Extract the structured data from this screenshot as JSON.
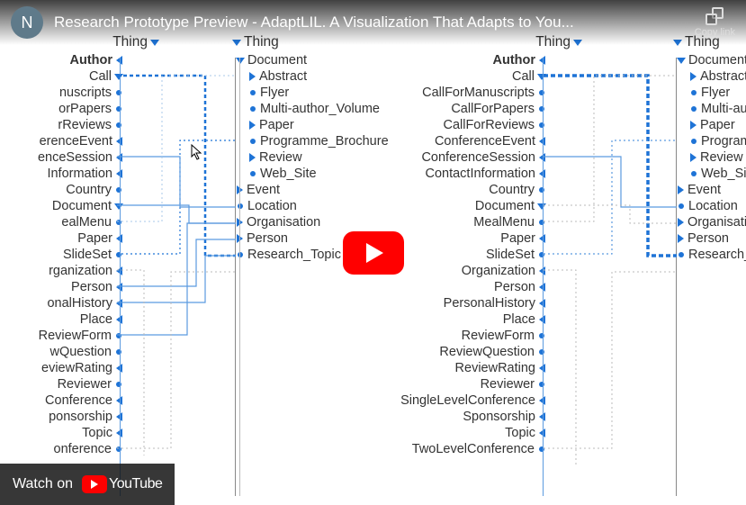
{
  "header": {
    "avatar_initial": "N",
    "title": "Research Prototype Preview - AdaptLIL. A Visualization That Adapts to You...",
    "copy_link": "Copy link"
  },
  "panels": {
    "p1": {
      "head": "Thing",
      "items": [
        {
          "label": "Author",
          "marker": "tri-left",
          "hi": true
        },
        {
          "label": "Call",
          "marker": "tri-down"
        },
        {
          "label": "nuscripts",
          "marker": "dot"
        },
        {
          "label": "orPapers",
          "marker": "dot"
        },
        {
          "label": "rReviews",
          "marker": "dot"
        },
        {
          "label": "erenceEvent",
          "marker": "tri-left"
        },
        {
          "label": "enceSession",
          "marker": "tri-left"
        },
        {
          "label": "Information",
          "marker": "tri-left"
        },
        {
          "label": "Country",
          "marker": "dot"
        },
        {
          "label": "Document",
          "marker": "tri-down"
        },
        {
          "label": "ealMenu",
          "marker": "dot"
        },
        {
          "label": "Paper",
          "marker": "tri-left"
        },
        {
          "label": "SlideSet",
          "marker": "dot"
        },
        {
          "label": "rganization",
          "marker": "tri-left"
        },
        {
          "label": "Person",
          "marker": "tri-left"
        },
        {
          "label": "onalHistory",
          "marker": "tri-left"
        },
        {
          "label": "Place",
          "marker": "tri-left"
        },
        {
          "label": "ReviewForm",
          "marker": "dot"
        },
        {
          "label": "wQuestion",
          "marker": "dot"
        },
        {
          "label": "eviewRating",
          "marker": "tri-left"
        },
        {
          "label": "Reviewer",
          "marker": "dot"
        },
        {
          "label": "Conference",
          "marker": "tri-left"
        },
        {
          "label": "ponsorship",
          "marker": "tri-left"
        },
        {
          "label": "Topic",
          "marker": "tri-left"
        },
        {
          "label": "onference",
          "marker": "dot"
        }
      ]
    },
    "p2": {
      "head": "Thing",
      "items": [
        {
          "label": "Document",
          "marker": "tri-down",
          "indent": 0
        },
        {
          "label": "Abstract",
          "marker": "tri-right",
          "indent": 1
        },
        {
          "label": "Flyer",
          "marker": "dot",
          "indent": 1
        },
        {
          "label": "Multi-author_Volume",
          "marker": "dot",
          "indent": 1
        },
        {
          "label": "Paper",
          "marker": "tri-right",
          "indent": 1
        },
        {
          "label": "Programme_Brochure",
          "marker": "dot",
          "indent": 1
        },
        {
          "label": "Review",
          "marker": "tri-right",
          "indent": 1
        },
        {
          "label": "Web_Site",
          "marker": "dot",
          "indent": 1
        },
        {
          "label": "Event",
          "marker": "tri-right",
          "indent": 0
        },
        {
          "label": "Location",
          "marker": "dot",
          "indent": 0
        },
        {
          "label": "Organisation",
          "marker": "tri-right",
          "indent": 0
        },
        {
          "label": "Person",
          "marker": "tri-right",
          "indent": 0
        },
        {
          "label": "Research_Topic",
          "marker": "dot",
          "indent": 0
        }
      ]
    },
    "p3": {
      "head": "Thing",
      "items": [
        {
          "label": "Author",
          "marker": "tri-left",
          "hi": true
        },
        {
          "label": "Call",
          "marker": "tri-down"
        },
        {
          "label": "CallForManuscripts",
          "marker": "dot"
        },
        {
          "label": "CallForPapers",
          "marker": "dot"
        },
        {
          "label": "CallForReviews",
          "marker": "dot"
        },
        {
          "label": "ConferenceEvent",
          "marker": "tri-left"
        },
        {
          "label": "ConferenceSession",
          "marker": "tri-left"
        },
        {
          "label": "ContactInformation",
          "marker": "tri-left"
        },
        {
          "label": "Country",
          "marker": "dot"
        },
        {
          "label": "Document",
          "marker": "tri-down"
        },
        {
          "label": "MealMenu",
          "marker": "dot"
        },
        {
          "label": "Paper",
          "marker": "tri-left"
        },
        {
          "label": "SlideSet",
          "marker": "dot"
        },
        {
          "label": "Organization",
          "marker": "tri-left"
        },
        {
          "label": "Person",
          "marker": "tri-left"
        },
        {
          "label": "PersonalHistory",
          "marker": "tri-left"
        },
        {
          "label": "Place",
          "marker": "tri-left"
        },
        {
          "label": "ReviewForm",
          "marker": "dot"
        },
        {
          "label": "ReviewQuestion",
          "marker": "dot"
        },
        {
          "label": "ReviewRating",
          "marker": "tri-left"
        },
        {
          "label": "Reviewer",
          "marker": "dot"
        },
        {
          "label": "SingleLevelConference",
          "marker": "tri-left"
        },
        {
          "label": "Sponsorship",
          "marker": "tri-left"
        },
        {
          "label": "Topic",
          "marker": "tri-left"
        },
        {
          "label": "TwoLevelConference",
          "marker": "dot"
        }
      ]
    },
    "p4": {
      "head": "Thing",
      "items": [
        {
          "label": "Document",
          "marker": "tri-down",
          "indent": 0
        },
        {
          "label": "Abstract",
          "marker": "tri-right",
          "indent": 1
        },
        {
          "label": "Flyer",
          "marker": "dot",
          "indent": 1
        },
        {
          "label": "Multi-autho",
          "marker": "dot",
          "indent": 1
        },
        {
          "label": "Paper",
          "marker": "tri-right",
          "indent": 1
        },
        {
          "label": "Programme",
          "marker": "dot",
          "indent": 1
        },
        {
          "label": "Review",
          "marker": "tri-right",
          "indent": 1
        },
        {
          "label": "Web_Site",
          "marker": "dot",
          "indent": 1
        },
        {
          "label": "Event",
          "marker": "tri-right",
          "indent": 0
        },
        {
          "label": "Location",
          "marker": "dot",
          "indent": 0
        },
        {
          "label": "Organisation",
          "marker": "tri-right",
          "indent": 0
        },
        {
          "label": "Person",
          "marker": "tri-right",
          "indent": 0
        },
        {
          "label": "Research_Topi",
          "marker": "dot",
          "indent": 0
        }
      ]
    }
  },
  "play_button": "Play",
  "watch": {
    "label": "Watch on",
    "brand": "YouTube"
  }
}
